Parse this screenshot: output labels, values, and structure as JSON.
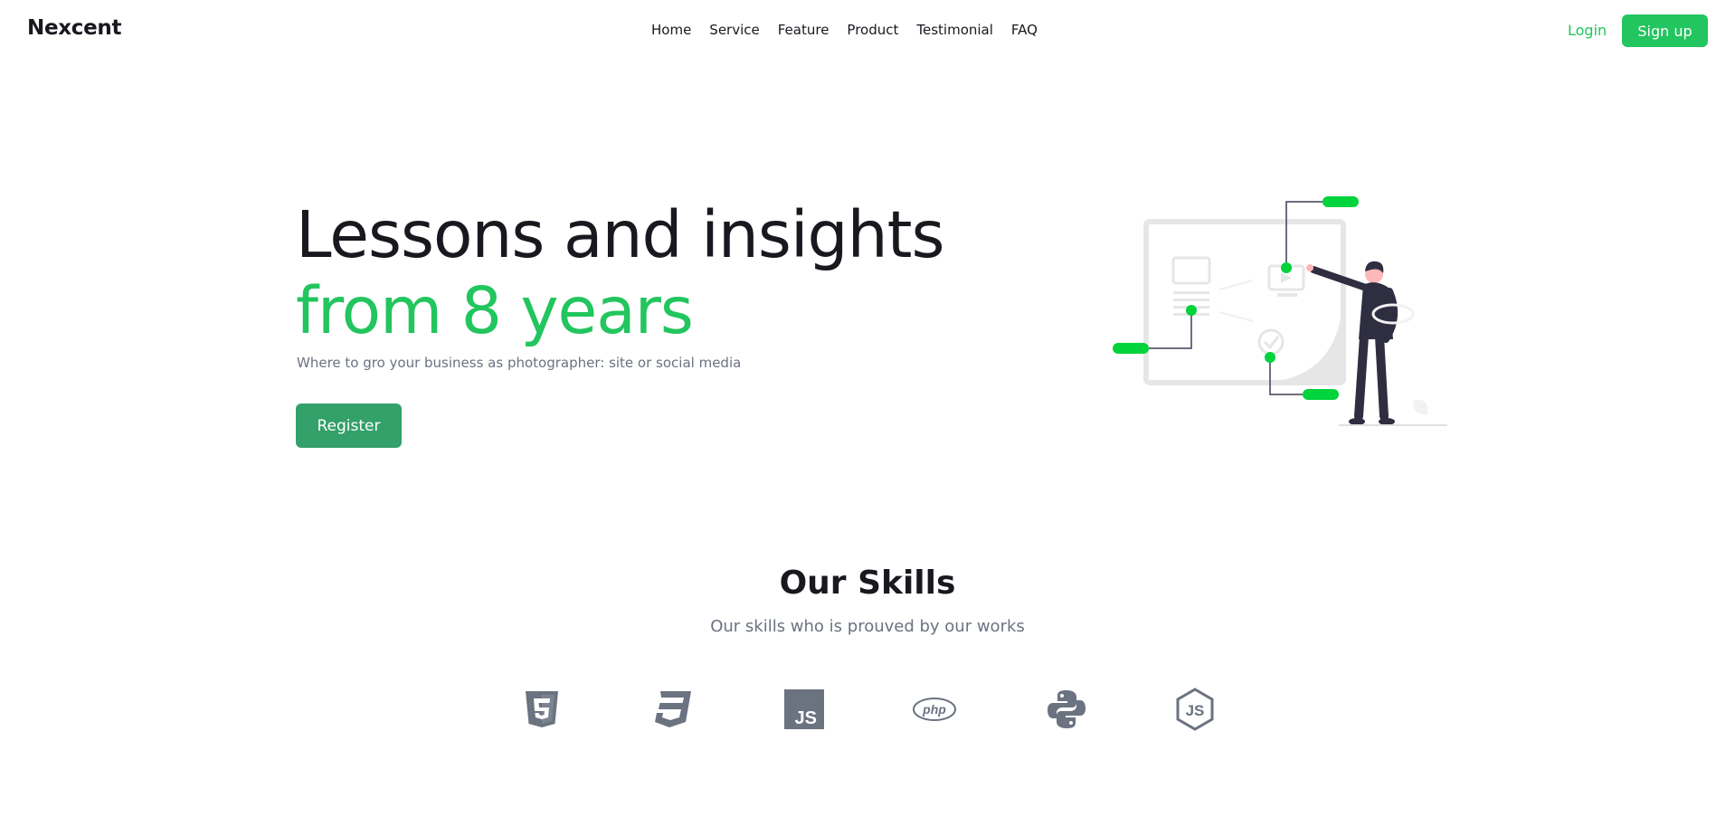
{
  "brand": {
    "name": "Nexcent"
  },
  "nav": {
    "links": [
      "Home",
      "Service",
      "Feature",
      "Product",
      "Testimonial",
      "FAQ"
    ],
    "login": "Login",
    "signup": "Sign up"
  },
  "hero": {
    "title_line1": "Lessons and insights",
    "title_line2": "from 8 years",
    "subtitle": "Where to gro your business as photographer: site or social media",
    "cta": "Register"
  },
  "skills": {
    "title": "Our Skills",
    "subtitle": "Our skills who is prouved by our works",
    "icons": [
      "html5-icon",
      "css3-icon",
      "javascript-icon",
      "php-icon",
      "python-icon",
      "nodejs-icon"
    ]
  },
  "colors": {
    "accent": "#22c55e",
    "cta": "#34a06a",
    "text": "#18191f",
    "muted": "#6b7280",
    "icon": "#6b7280"
  }
}
